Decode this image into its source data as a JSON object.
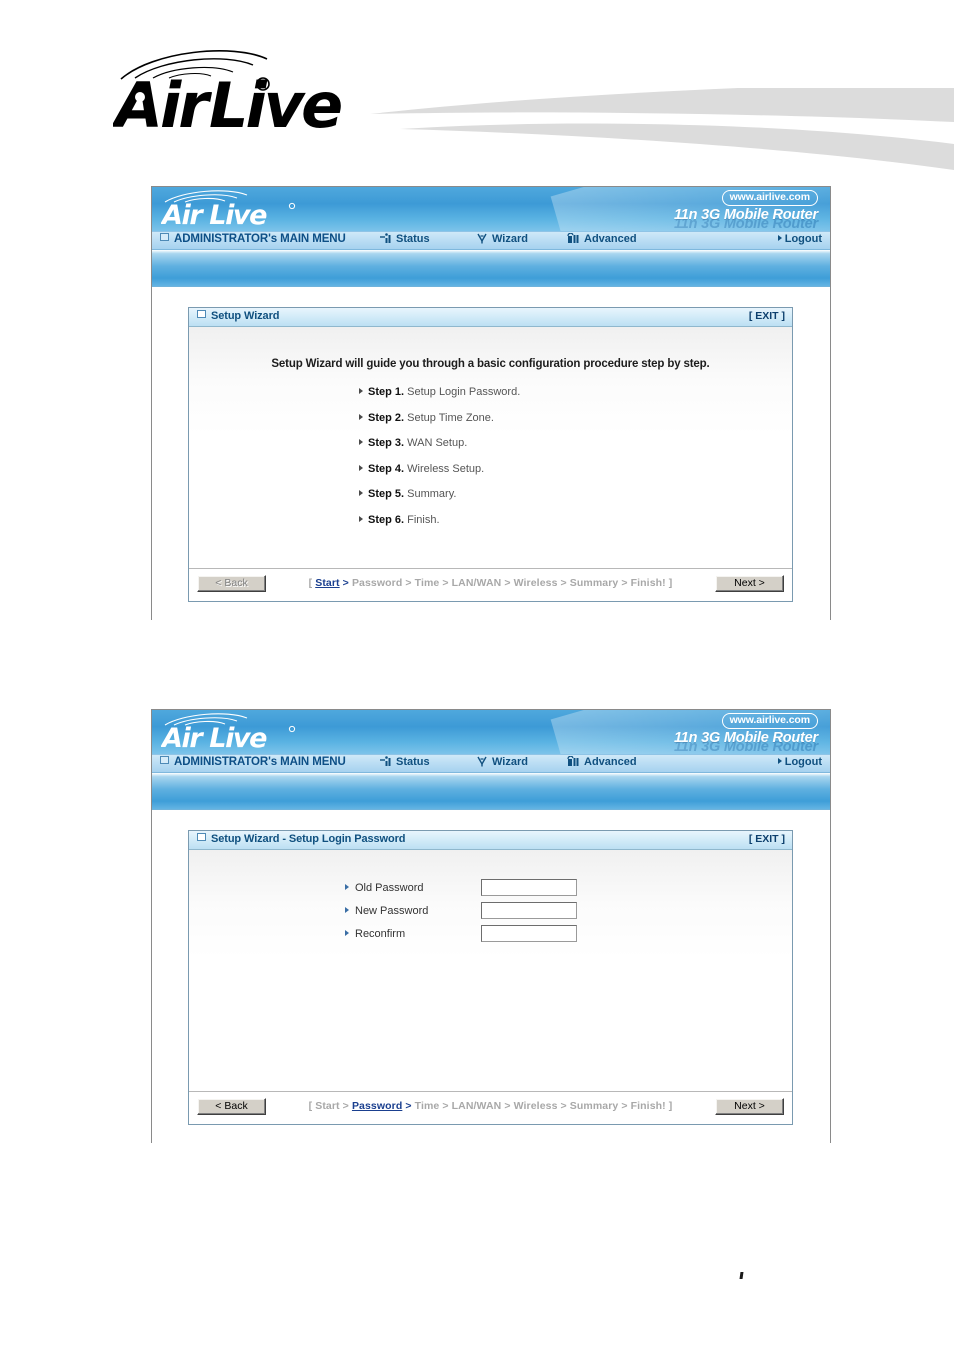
{
  "page": {
    "brand_logo": "airlive-logo",
    "brand_name": "Air Live",
    "registered_mark": "®"
  },
  "router_ui": {
    "banner": {
      "logo": "airlive-logo",
      "url_badge": "www.airlive.com",
      "product_name": "11n 3G Mobile Router"
    },
    "menubar": {
      "admin_label": "ADMINISTRATOR's MAIN MENU",
      "items": [
        {
          "label": "Status",
          "icon": "signal-bars-icon"
        },
        {
          "label": "Wizard",
          "icon": "magic-wand-icon"
        },
        {
          "label": "Advanced",
          "icon": "gauge-bars-icon"
        }
      ],
      "logout_label": "Logout"
    }
  },
  "screenshot_1": {
    "panel": {
      "title": "Setup Wizard",
      "exit_label": "[ EXIT ]"
    },
    "intro": "Setup Wizard will guide you through a basic configuration procedure step by step.",
    "steps": [
      {
        "num": "Step 1.",
        "text": "Setup Login Password."
      },
      {
        "num": "Step 2.",
        "text": "Setup Time Zone."
      },
      {
        "num": "Step 3.",
        "text": "WAN Setup."
      },
      {
        "num": "Step 4.",
        "text": "Wireless Setup."
      },
      {
        "num": "Step 5.",
        "text": "Summary."
      },
      {
        "num": "Step 6.",
        "text": "Finish."
      }
    ],
    "footer": {
      "back_label": "< Back",
      "next_label": "Next >",
      "back_disabled": true,
      "breadcrumb": {
        "open": "[",
        "close": "]",
        "active": "Start",
        "items": [
          "Start",
          "Password",
          "Time",
          "LAN/WAN",
          "Wireless",
          "Summary",
          "Finish!"
        ]
      }
    }
  },
  "screenshot_2": {
    "panel": {
      "title": "Setup Wizard - Setup Login Password",
      "exit_label": "[ EXIT ]"
    },
    "fields": [
      {
        "label": "Old Password",
        "value": "",
        "placeholder": ""
      },
      {
        "label": "New Password",
        "value": "",
        "placeholder": ""
      },
      {
        "label": "Reconfirm",
        "value": "",
        "placeholder": ""
      }
    ],
    "footer": {
      "back_label": "< Back",
      "next_label": "Next >",
      "back_disabled": false,
      "breadcrumb": {
        "open": "[",
        "close": "]",
        "active": "Password",
        "items": [
          "Start",
          "Password",
          "Time",
          "LAN/WAN",
          "Wireless",
          "Summary",
          "Finish!"
        ]
      }
    }
  },
  "colors": {
    "banner_blue": "#3d9ad6",
    "menubar_blue": "#bcdef4",
    "panel_title_blue": "#d2ebf8",
    "link_blue": "#1a3f8f",
    "text_gray": "#a8a8a8",
    "button_face": "#d4d0c8"
  }
}
